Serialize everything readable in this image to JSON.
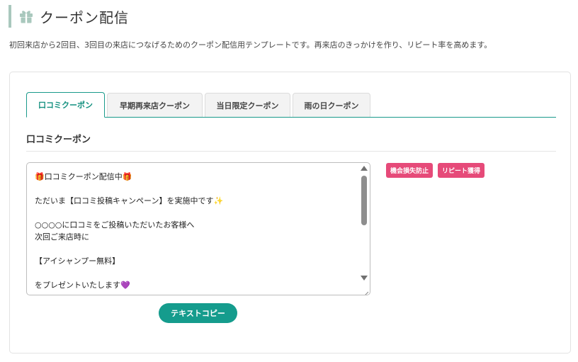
{
  "header": {
    "icon": "gift-icon",
    "title": "クーポン配信",
    "description": "初回来店から2回目、3回目の来店につなげるためのクーポン配信用テンプレートです。再来店のきっかけを作り、リピート率を高めます。"
  },
  "tabs": [
    {
      "label": "口コミクーポン",
      "active": true
    },
    {
      "label": "早期再来店クーポン",
      "active": false
    },
    {
      "label": "当日限定クーポン",
      "active": false
    },
    {
      "label": "雨の日クーポン",
      "active": false
    }
  ],
  "section": {
    "title": "口コミクーポン",
    "template_text": "🎁口コミクーポン配信中🎁\n\nただいま【口コミ投稿キャンペーン】を実施中です✨\n\n○○○○に口コミをご投稿いただいたお客様へ\n次回ご来店時に\n\n【アイシャンプー無料】\n\nをプレゼントいたします💜",
    "tags": [
      "機会損失防止",
      "リピート獲得"
    ],
    "copy_button_label": "テキストコピー"
  },
  "colors": {
    "accent": "#159c8d",
    "tag": "#e64a79",
    "header_bar": "#a9c8bd"
  }
}
